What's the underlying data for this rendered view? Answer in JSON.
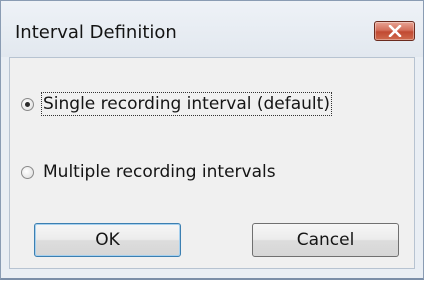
{
  "window": {
    "title": "Interval Definition"
  },
  "options": [
    {
      "label": "Single recording interval (default)",
      "selected": true
    },
    {
      "label": "Multiple recording intervals",
      "selected": false
    }
  ],
  "buttons": {
    "ok_label": "OK",
    "cancel_label": "Cancel"
  },
  "icons": {
    "close": "close-icon"
  },
  "colors": {
    "close_button": "#c8523a",
    "dialog_background": "#f0f0f0",
    "frame": "#e9eef4"
  }
}
